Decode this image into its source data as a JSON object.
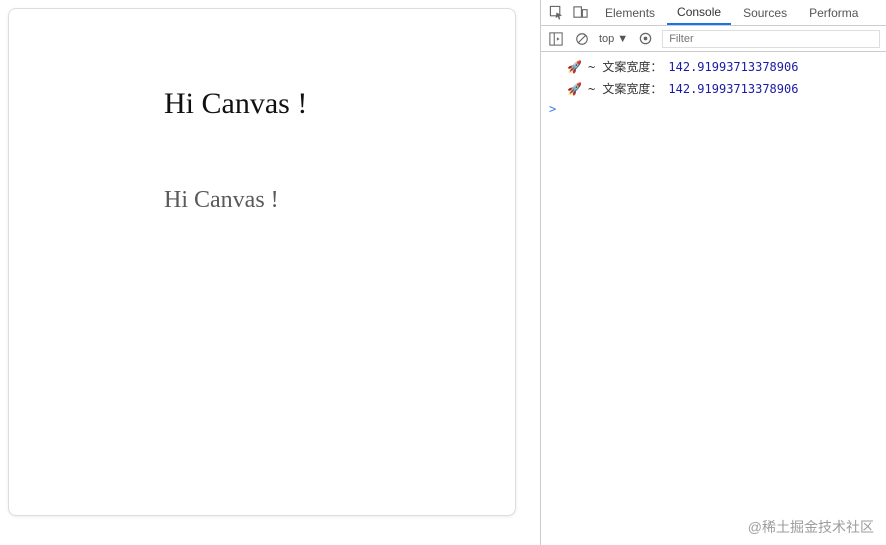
{
  "page": {
    "canvas_text_large": "Hi Canvas !",
    "canvas_text_small": "Hi Canvas !"
  },
  "devtools": {
    "tabs": {
      "elements": "Elements",
      "console": "Console",
      "sources": "Sources",
      "performance": "Performa"
    },
    "active_tab": "Console",
    "toolbar": {
      "context_label": "top",
      "filter_placeholder": "Filter"
    },
    "console_logs": [
      {
        "label": "~ 文案宽度：",
        "value": "142.91993713378906"
      },
      {
        "label": "~ 文案宽度：",
        "value": "142.91993713378906"
      }
    ],
    "prompt_symbol": ">"
  },
  "watermark": "@稀土掘金技术社区"
}
